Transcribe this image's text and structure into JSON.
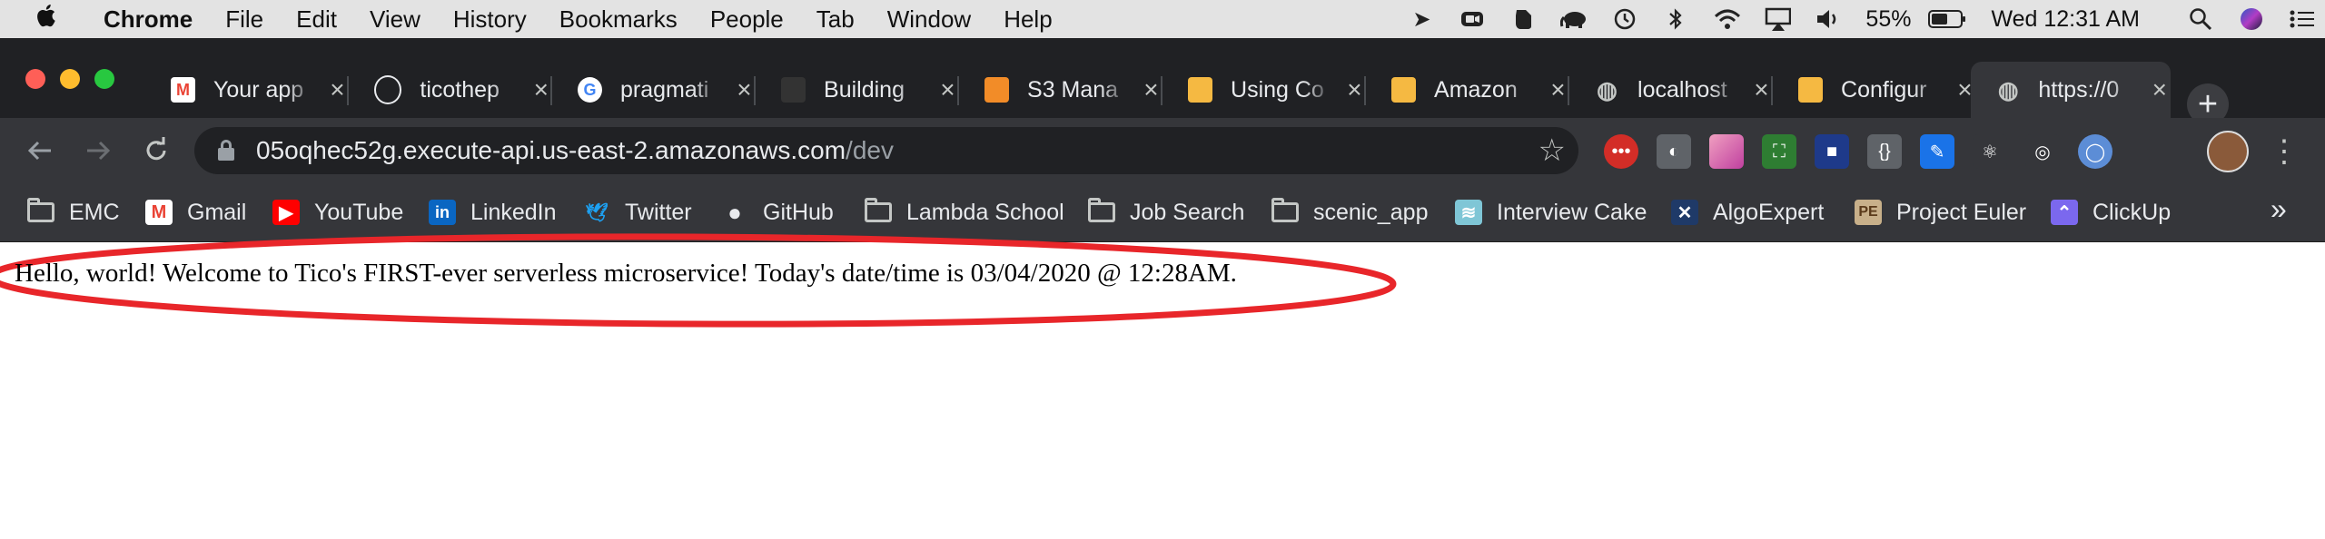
{
  "menubar": {
    "apple_icon": "apple-logo",
    "app_name": "Chrome",
    "items": [
      "File",
      "Edit",
      "View",
      "History",
      "Bookmarks",
      "People",
      "Tab",
      "Window",
      "Help"
    ],
    "status_icons": [
      "location-arrow-icon",
      "zoom-icon",
      "evernote-icon",
      "elephant-icon",
      "time-machine-icon",
      "bluetooth-icon",
      "wifi-icon",
      "airplay-icon",
      "volume-icon"
    ],
    "battery": "55%",
    "clock": "Wed 12:31 AM"
  },
  "tabs": [
    {
      "title": "Your app",
      "icon": "gmail-icon",
      "color": "#ea4335"
    },
    {
      "title": "ticothep",
      "icon": "github-icon",
      "color": "#e8eaed"
    },
    {
      "title": "pragmati",
      "icon": "google-icon",
      "color": "#4285f4"
    },
    {
      "title": "Building",
      "icon": "serverless-icon",
      "color": "#333333"
    },
    {
      "title": "S3 Mana",
      "icon": "aws-s3-icon",
      "color": "#f28c28"
    },
    {
      "title": "Using Co",
      "icon": "aws-docs-icon",
      "color": "#f5b942"
    },
    {
      "title": "Amazon",
      "icon": "aws-docs-icon",
      "color": "#f5b942"
    },
    {
      "title": "localhost",
      "icon": "globe-icon",
      "color": "#c4c7c5"
    },
    {
      "title": "Configur",
      "icon": "aws-docs-icon",
      "color": "#f5b942"
    },
    {
      "title": "https://0",
      "icon": "globe-icon",
      "color": "#c4c7c5",
      "active": true
    }
  ],
  "address": {
    "host": "05oqhec52g.execute-api.us-east-2.amazonaws.com",
    "path": "/dev"
  },
  "extensions": [
    {
      "name": "lastpass-icon",
      "color": "#d32d27",
      "glyph": "•••"
    },
    {
      "name": "extension-gray-icon",
      "color": "#5f6368",
      "glyph": "◐"
    },
    {
      "name": "gradient-extension-icon",
      "color": "#e05aa0",
      "glyph": ""
    },
    {
      "name": "screenshot-extension-icon",
      "color": "#2e7d32",
      "glyph": "⛶"
    },
    {
      "name": "box-extension-icon",
      "color": "#1e3a8a",
      "glyph": "■"
    },
    {
      "name": "json-extension-icon",
      "color": "#5f6368",
      "glyph": "{}"
    },
    {
      "name": "color-picker-icon",
      "color": "#1a73e8",
      "glyph": "✎"
    },
    {
      "name": "react-devtools-icon",
      "color": "#35363a",
      "glyph": "⚛"
    },
    {
      "name": "target-extension-icon",
      "color": "#35363a",
      "glyph": "◎"
    },
    {
      "name": "blue-circle-extension-icon",
      "color": "#5c8dd6",
      "glyph": "◯"
    }
  ],
  "bookmarks": [
    {
      "label": "EMC",
      "icon": "folder-icon",
      "color": ""
    },
    {
      "label": "Gmail",
      "icon": "gmail-icon",
      "color": "#ea4335"
    },
    {
      "label": "YouTube",
      "icon": "youtube-icon",
      "color": "#ff0000"
    },
    {
      "label": "LinkedIn",
      "icon": "linkedin-icon",
      "color": "#0a66c2"
    },
    {
      "label": "Twitter",
      "icon": "twitter-icon",
      "color": "#1da1f2"
    },
    {
      "label": "GitHub",
      "icon": "github-icon",
      "color": "#e8eaed"
    },
    {
      "label": "Lambda School",
      "icon": "folder-icon",
      "color": ""
    },
    {
      "label": "Job Search",
      "icon": "folder-icon",
      "color": ""
    },
    {
      "label": "scenic_app",
      "icon": "folder-icon",
      "color": ""
    },
    {
      "label": "Interview Cake",
      "icon": "interview-cake-icon",
      "color": "#7fc6d6"
    },
    {
      "label": "AlgoExpert",
      "icon": "algoexpert-icon",
      "color": "#1f3a68"
    },
    {
      "label": "Project Euler",
      "icon": "project-euler-icon",
      "color": "#c8b08a"
    },
    {
      "label": "ClickUp",
      "icon": "clickup-icon",
      "color": "#7b68ee"
    }
  ],
  "page": {
    "message": "Hello, world! Welcome to Tico's FIRST-ever serverless microservice! Today's date/time is 03/04/2020 @ 12:28AM."
  },
  "colors": {
    "annotation": "#e8262a",
    "tab_strip": "#202124",
    "toolbar": "#35363a"
  }
}
